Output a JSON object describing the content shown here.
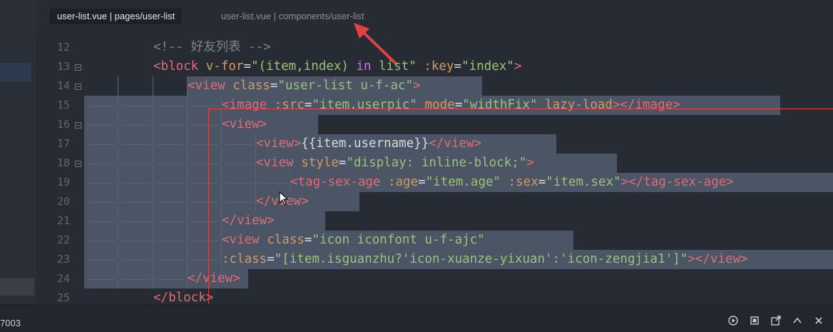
{
  "tabs": [
    {
      "label": "user-list.vue | pages/user-list",
      "active": true
    },
    {
      "label": "user-list.vue | components/user-list",
      "active": false
    }
  ],
  "colors": {
    "accent_red": "#e0433f",
    "selection": "#4c5565",
    "background": "#272b33"
  },
  "editor": {
    "line_numbers": [
      "12",
      "13",
      "14",
      "15",
      "16",
      "17",
      "18",
      "19",
      "20",
      "21",
      "22",
      "23",
      "24",
      "25"
    ],
    "lines": [
      [
        [
          "t-com",
          "<!-- 好友列表 -->"
        ]
      ],
      [
        [
          "t-tag",
          "<block"
        ],
        [
          "t-p",
          " "
        ],
        [
          "t-attr",
          "v-for"
        ],
        [
          "t-p",
          "="
        ],
        [
          "t-str",
          "\"(item,index) "
        ],
        [
          "t-kw",
          "in"
        ],
        [
          "t-str",
          " list\""
        ],
        [
          "t-p",
          " "
        ],
        [
          "t-attr",
          ":key"
        ],
        [
          "t-p",
          "="
        ],
        [
          "t-str",
          "\"index\""
        ],
        [
          "t-tag",
          ">"
        ]
      ],
      [
        [
          "t-tag",
          "<view"
        ],
        [
          "t-p",
          " "
        ],
        [
          "t-attr",
          "class"
        ],
        [
          "t-p",
          "="
        ],
        [
          "t-str",
          "\"user-list u-f-ac\""
        ],
        [
          "t-tag",
          ">"
        ]
      ],
      [
        [
          "t-tag",
          "<image"
        ],
        [
          "t-p",
          " "
        ],
        [
          "t-attr",
          ":src"
        ],
        [
          "t-p",
          "="
        ],
        [
          "t-str",
          "\"item.userpic\""
        ],
        [
          "t-p",
          " "
        ],
        [
          "t-attr",
          "mode"
        ],
        [
          "t-p",
          "="
        ],
        [
          "t-str",
          "\"widthFix\""
        ],
        [
          "t-p",
          " "
        ],
        [
          "t-attr",
          "lazy-load"
        ],
        [
          "t-tag",
          "></image>"
        ]
      ],
      [
        [
          "t-tag",
          "<view>"
        ]
      ],
      [
        [
          "t-tag",
          "<view>"
        ],
        [
          "t-p",
          "{{item.username}}"
        ],
        [
          "t-tag",
          "</view>"
        ]
      ],
      [
        [
          "t-tag",
          "<view"
        ],
        [
          "t-p",
          " "
        ],
        [
          "t-attr",
          "style"
        ],
        [
          "t-p",
          "="
        ],
        [
          "t-str",
          "\"display: inline-block;\""
        ],
        [
          "t-tag",
          ">"
        ]
      ],
      [
        [
          "t-tag",
          "<tag-sex-age"
        ],
        [
          "t-p",
          " "
        ],
        [
          "t-attr",
          ":age"
        ],
        [
          "t-p",
          "="
        ],
        [
          "t-str",
          "\"item.age\""
        ],
        [
          "t-p",
          " "
        ],
        [
          "t-attr",
          ":sex"
        ],
        [
          "t-p",
          "="
        ],
        [
          "t-str",
          "\"item.sex\""
        ],
        [
          "t-tag",
          "></tag-sex-age>"
        ]
      ],
      [
        [
          "t-tag",
          "</view>"
        ]
      ],
      [
        [
          "t-tag",
          "</view>"
        ]
      ],
      [
        [
          "t-tag",
          "<view"
        ],
        [
          "t-p",
          " "
        ],
        [
          "t-attr",
          "class"
        ],
        [
          "t-p",
          "="
        ],
        [
          "t-str",
          "\"icon iconfont u-f-ajc\""
        ]
      ],
      [
        [
          "t-attr",
          ":class"
        ],
        [
          "t-p",
          "="
        ],
        [
          "t-str",
          "\"[item.isguanzhu?'icon-xuanze-yixuan':'icon-zengjia1']\""
        ],
        [
          "t-tag",
          "></view>"
        ]
      ],
      [
        [
          "t-tag",
          "</view>"
        ]
      ],
      [
        [
          "t-tag",
          "</block>"
        ]
      ]
    ]
  },
  "status": {
    "port_text": "7003"
  },
  "bottom_icons": [
    "play-circle-icon",
    "stop-square-icon",
    "export-icon",
    "chevron-up-icon",
    "close-icon"
  ]
}
